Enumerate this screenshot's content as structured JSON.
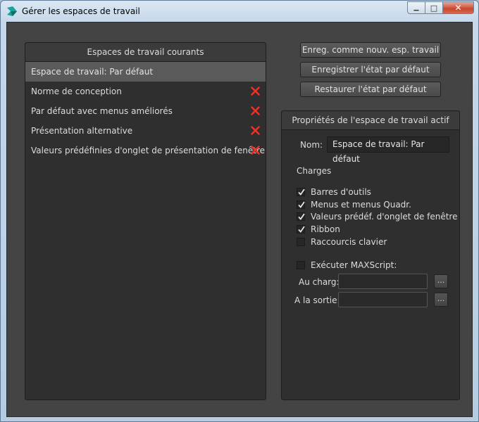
{
  "window": {
    "title": "Gérer les espaces de travail",
    "minimize_label": "▁",
    "maximize_label": "□",
    "close_label": "✕"
  },
  "left_panel": {
    "header": "Espaces de travail courants",
    "items": [
      {
        "label": "Espace de travail: Par défaut",
        "deletable": false
      },
      {
        "label": "Norme de conception",
        "deletable": true
      },
      {
        "label": "Par défaut avec menus améliorés",
        "deletable": true
      },
      {
        "label": "Présentation alternative",
        "deletable": true
      },
      {
        "label": "Valeurs prédéfinies d'onglet de présentation de fenêtre",
        "deletable": true
      }
    ],
    "delete_icon_color": "#e8352b"
  },
  "buttons": {
    "save_new": "Enreg. comme nouv. esp. travail",
    "save_default": "Enregistrer l'état par défaut",
    "restore_default": "Restaurer l'état par défaut"
  },
  "properties": {
    "header": "Propriétés de l'espace de travail actif",
    "name_label": "Nom:",
    "name_value": "Espace de travail: Par défaut",
    "loads_label": "Charges",
    "loads": [
      {
        "label": "Barres d'outils",
        "checked": true
      },
      {
        "label": "Menus et menus Quadr.",
        "checked": true
      },
      {
        "label": "Valeurs prédéf. d'onglet de fenêtre",
        "checked": true
      },
      {
        "label": "Ribbon",
        "checked": true
      },
      {
        "label": "Raccourcis clavier",
        "checked": false
      }
    ],
    "maxscript": {
      "label": "Exécuter MAXScript:",
      "checked": false
    },
    "on_load_label": "Au charg:",
    "on_exit_label": "A la sortie:",
    "browse_label": "..."
  }
}
